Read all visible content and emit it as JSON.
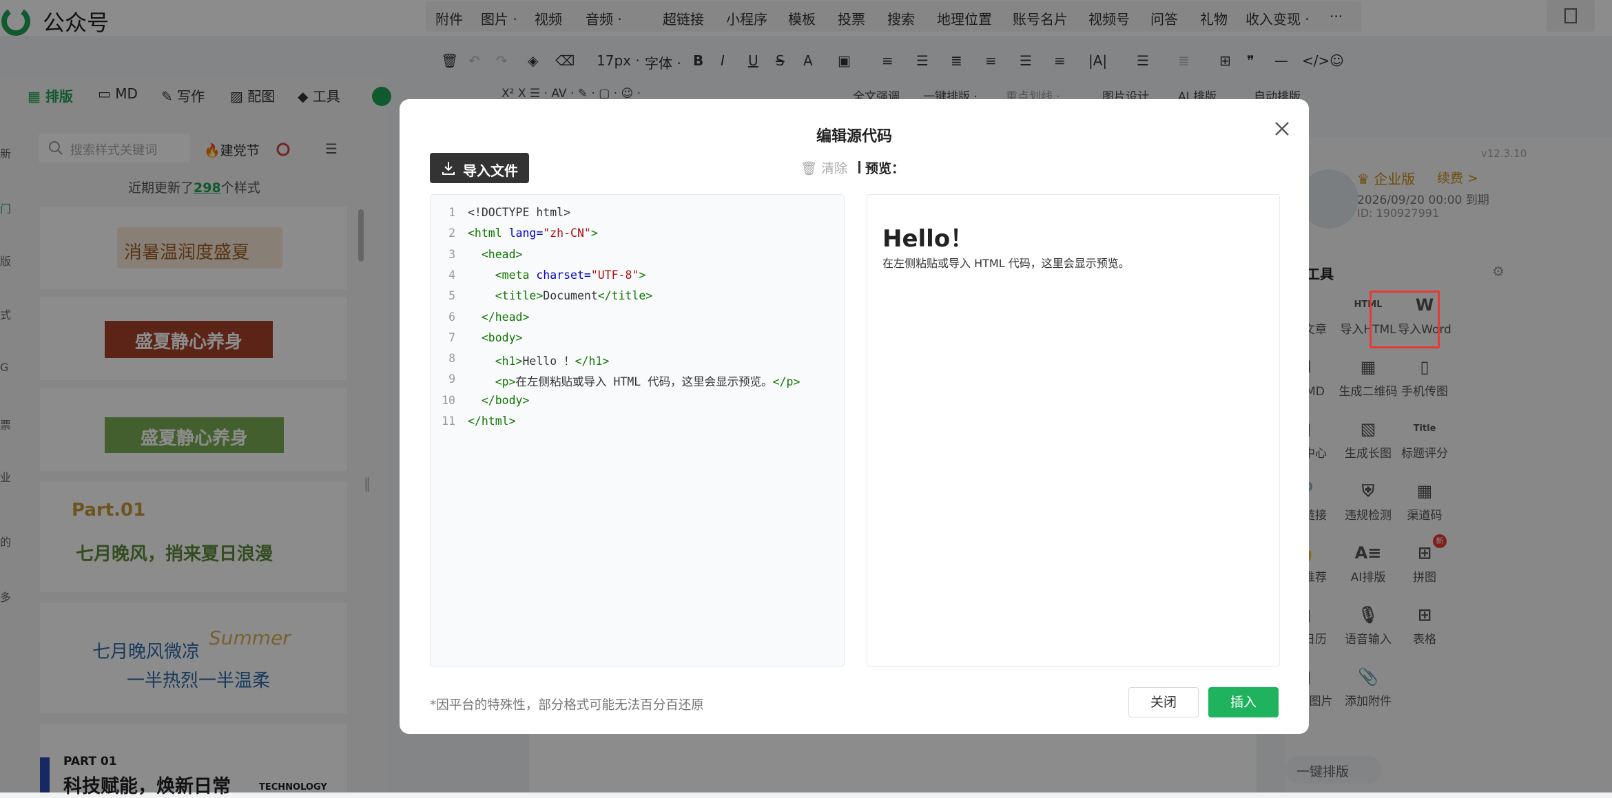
{
  "app": {
    "name": "公众号"
  },
  "top_menu": [
    "附件",
    "图片 ·",
    "视频",
    "音频 ·",
    "超链接",
    "小程序",
    "模板",
    "投票",
    "搜索",
    "地理位置",
    "账号名片",
    "视频号",
    "问答",
    "礼物",
    "收入变现 ·",
    "···"
  ],
  "toolbar": {
    "font_size": "17px ·",
    "font_family": "字体 ·"
  },
  "toolbar2": [
    "X²  X  ☰ ·  AV ·  ✎ ·  ▢ ·  ☺ ·",
    "全文强调",
    "一键排版 ·",
    "重点划线 ·",
    "图片设计",
    "AI 排版",
    "自动排版"
  ],
  "left_tabs": [
    "排版",
    "MD",
    "写作",
    "配图",
    "工具"
  ],
  "left_search": {
    "placeholder": "搜索样式关键词",
    "filter": "建党节"
  },
  "left_note": {
    "prefix": "近期更新了",
    "count": "298",
    "suffix": "个样式"
  },
  "cards": [
    {
      "text": "消暑温润度盛夏"
    },
    {
      "text": "盛夏静心养身"
    },
    {
      "text": "盛夏静心养身"
    },
    {
      "line1": "Part.01",
      "line2": "七月晚风，捎来夏日浪漫"
    },
    {
      "line1": "七月晚风微凉",
      "line2": "一半热烈一半温柔",
      "deco": "Summer"
    },
    {
      "line1": "PART 01",
      "line2": "科技赋能，焕新日常",
      "tag": "TECHNOLOGY"
    }
  ],
  "left_edge": [
    "新",
    "门",
    "版",
    "式",
    "G",
    "票",
    "业",
    "的",
    "多"
  ],
  "account": {
    "version": "v12.3.10",
    "tier": "企业版",
    "renew": "续费 >",
    "expire": "2026/09/20 00:00 到期",
    "id": "ID: 190927991"
  },
  "tools_title": "用工具",
  "tools": [
    {
      "label": "导入文章",
      "icon": "download-icon"
    },
    {
      "label": "导入HTML",
      "icon": "html-icon"
    },
    {
      "label": "导入Word",
      "icon": "word-icon"
    },
    {
      "label": "导入MD",
      "icon": "markdown-icon"
    },
    {
      "label": "生成二维码",
      "icon": "qrcode-icon"
    },
    {
      "label": "手机传图",
      "icon": "phone-upload-icon"
    },
    {
      "label": "配图中心",
      "icon": "image-icon"
    },
    {
      "label": "生成长图",
      "icon": "long-image-icon"
    },
    {
      "label": "标题评分",
      "icon": "title-icon"
    },
    {
      "label": "永久链接",
      "icon": "link-icon"
    },
    {
      "label": "违规检测",
      "icon": "shield-icon"
    },
    {
      "label": "渠道码",
      "icon": "channel-code-icon"
    },
    {
      "label": "往期推荐",
      "icon": "thumbs-up-icon"
    },
    {
      "label": "AI排版",
      "icon": "ai-layout-icon"
    },
    {
      "label": "拼图",
      "icon": "collage-icon",
      "badge": "新"
    },
    {
      "label": "营销日历",
      "icon": "calendar-icon"
    },
    {
      "label": "语音输入",
      "icon": "microphone-icon"
    },
    {
      "label": "表格",
      "icon": "table-icon"
    },
    {
      "label": "长文转图片",
      "icon": "text-to-image-icon"
    },
    {
      "label": "添加附件",
      "icon": "paperclip-icon"
    }
  ],
  "bottom_right_btn": "一键排版",
  "modal": {
    "title": "编辑源代码",
    "import_button": "导入文件",
    "clear_button": "清除",
    "preview_label": "预览：",
    "code_lines": [
      [
        "<!DOCTYPE html>"
      ],
      [
        "<html",
        " lang=",
        "\"zh-CN\"",
        ">"
      ],
      [
        "  <head>"
      ],
      [
        "    <meta",
        " charset=",
        "\"UTF-8\"",
        ">"
      ],
      [
        "    <title>",
        "Document",
        "</title>"
      ],
      [
        "  </head>"
      ],
      [
        "  <body>"
      ],
      [
        "    <h1>",
        "Hello ！",
        "</h1>"
      ],
      [
        "    <p>",
        "在左侧粘贴或导入 HTML 代码，这里会显示预览。",
        "</p>"
      ],
      [
        "  </body>"
      ],
      [
        "</html>"
      ]
    ],
    "preview": {
      "h1": "Hello！",
      "p": "在左侧粘贴或导入 HTML 代码，这里会显示预览。"
    },
    "footnote": "*因平台的特殊性，部分格式可能无法百分百还原",
    "cancel": "关闭",
    "confirm": "插入"
  },
  "colors": {
    "accent": "#1fb35d",
    "highlight": "#e53935",
    "tag": "#117700",
    "attr": "#0000cc",
    "string": "#aa1111"
  }
}
